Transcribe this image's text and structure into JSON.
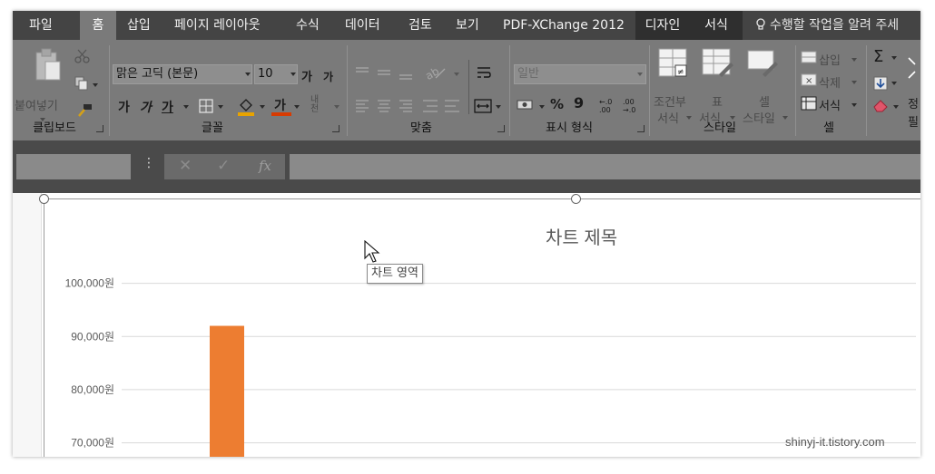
{
  "tabs": [
    {
      "label": "파일",
      "active": false
    },
    {
      "label": "홈",
      "active": true
    },
    {
      "label": "삽입",
      "active": false
    },
    {
      "label": "페이지 레이아웃",
      "active": false
    },
    {
      "label": "수식",
      "active": false
    },
    {
      "label": "데이터",
      "active": false
    },
    {
      "label": "검토",
      "active": false
    },
    {
      "label": "보기",
      "active": false
    },
    {
      "label": "PDF-XChange 2012",
      "active": false
    },
    {
      "label": "디자인",
      "active": false,
      "contextual": true
    },
    {
      "label": "서식",
      "active": false,
      "contextual": true
    }
  ],
  "tell_me": "수행할 작업을 알려 주세",
  "ribbon": {
    "clipboard": {
      "paste_label": "붙여넣기",
      "group_label": "클립보드"
    },
    "font": {
      "font_name": "맑은 고딕 (본문)",
      "font_size": "10",
      "grow_label": "가",
      "shrink_label": "가",
      "bold_label": "가",
      "italic_label": "가",
      "underline_label": "가",
      "font_color_label": "가",
      "phonetic_label": "내천",
      "group_label": "글꼴"
    },
    "alignment": {
      "group_label": "맞춤"
    },
    "number": {
      "format": "일반",
      "percent_label": "%",
      "comma_label": "9",
      "inc_decimal_label": "←.0 .00",
      "dec_decimal_label": ".00 →.0",
      "group_label": "표시 형식"
    },
    "styles": {
      "conditional_label_1": "조건부",
      "conditional_label_2": "서식",
      "table_label_1": "표",
      "table_label_2": "서식",
      "cell_label_1": "셀",
      "cell_label_2": "스타일",
      "group_label": "스타일"
    },
    "cells": {
      "insert_label": "삽입",
      "delete_label": "삭제",
      "format_label": "서식",
      "group_label": "셀"
    },
    "editing": {
      "sum_label": "Σ",
      "sort_label": "정",
      "find_label": "필"
    }
  },
  "formula_bar": {
    "name_box_value": "",
    "fx_label": "fx",
    "cancel_symbol": "✕",
    "enter_symbol": "✓",
    "formula_value": ""
  },
  "chart_area_tooltip": "차트 영역",
  "watermark": "shinyj-it.tistory.com",
  "chart_data": {
    "type": "bar",
    "title": "차트 제목",
    "ytick_labels": [
      "100,000원",
      "90,000원",
      "80,000원",
      "70,000원"
    ],
    "yticks": [
      100000,
      90000,
      80000,
      70000
    ],
    "ylim_visible": [
      65500,
      103000
    ],
    "grid": true,
    "series": [
      {
        "values": [
          92000
        ],
        "color": "#ED7D31"
      }
    ]
  }
}
